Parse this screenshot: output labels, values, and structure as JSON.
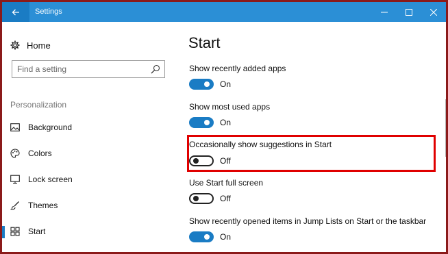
{
  "window": {
    "title": "Settings"
  },
  "sidebar": {
    "home_label": "Home",
    "search_placeholder": "Find a setting",
    "section_header": "Personalization",
    "items": [
      {
        "label": "Background",
        "icon": "picture-icon"
      },
      {
        "label": "Colors",
        "icon": "palette-icon"
      },
      {
        "label": "Lock screen",
        "icon": "monitor-icon"
      },
      {
        "label": "Themes",
        "icon": "brush-icon"
      },
      {
        "label": "Start",
        "icon": "start-icon",
        "active": true
      }
    ]
  },
  "main": {
    "title": "Start",
    "settings": [
      {
        "label": "Show recently added apps",
        "state": "On"
      },
      {
        "label": "Show most used apps",
        "state": "On"
      },
      {
        "label": "Occasionally show suggestions in Start",
        "state": "Off"
      },
      {
        "label": "Use Start full screen",
        "state": "Off"
      },
      {
        "label": "Show recently opened items in Jump Lists on Start or the taskbar",
        "state": "On"
      }
    ]
  },
  "colors": {
    "accent": "#1a7cc4",
    "titlebar": "#2b8fd6",
    "highlight": "#e00000",
    "frame": "#8b1a1a"
  }
}
